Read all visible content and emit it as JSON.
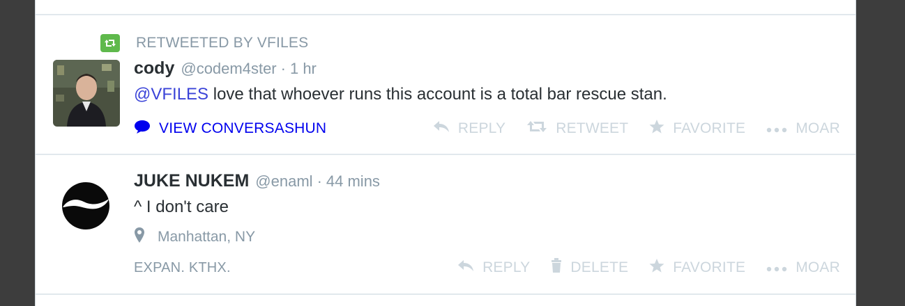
{
  "colors": {
    "retweet_badge": "#5fb94c",
    "muted_text": "#8899a6",
    "action_text": "#ccd6dd",
    "link": "#0000ee",
    "mention": "#3b44d8"
  },
  "tweets": [
    {
      "retweet_context": "RETWEETED BY VFILES",
      "name": "cody",
      "handle": "@codem4ster",
      "separator": "·",
      "time": "1 hr",
      "mention": "@VFILES",
      "text": " love that whoever runs this account is a total bar rescue stan.",
      "conversation_link": "VIEW CONVERSASHUN",
      "avatar_icon": "profile-photo",
      "actions": [
        {
          "label": "REPLY",
          "icon": "reply-icon"
        },
        {
          "label": "RETWEET",
          "icon": "retweet-icon"
        },
        {
          "label": "FAVORITE",
          "icon": "star-icon"
        },
        {
          "label": "MOAR",
          "icon": "more-dots-icon"
        }
      ]
    },
    {
      "name": "JUKE NUKEM",
      "handle": "@enaml",
      "separator": "·",
      "time": "44 mins",
      "text": "^ I don't care",
      "location": "Manhattan, NY",
      "expand_label": "EXPAN. KTHX.",
      "avatar_icon": "yin-yang-logo",
      "actions": [
        {
          "label": "REPLY",
          "icon": "reply-icon"
        },
        {
          "label": "DELETE",
          "icon": "trash-icon"
        },
        {
          "label": "FAVORITE",
          "icon": "star-icon"
        },
        {
          "label": "MOAR",
          "icon": "more-dots-icon"
        }
      ]
    }
  ]
}
